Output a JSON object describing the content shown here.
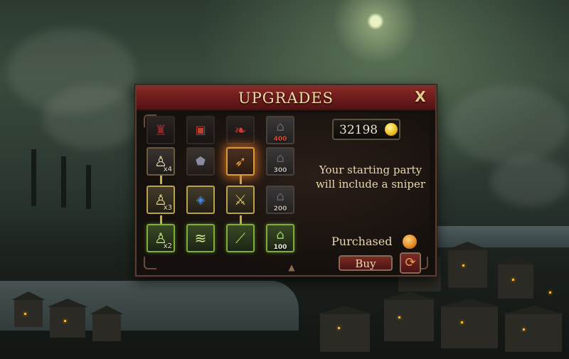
{
  "dialog": {
    "title": "UPGRADES",
    "close_label": "X"
  },
  "currency": {
    "gold": "32198",
    "coin_icon": "gold-coin-icon"
  },
  "upgrade_grid": {
    "rows": [
      [
        {
          "icon": "dynamite-figure-icon",
          "state": "dim"
        },
        {
          "icon": "supply-crate-icon",
          "state": "dim"
        },
        {
          "icon": "blade-icon",
          "state": "dim"
        },
        {
          "icon": "building-icon",
          "state": "locked",
          "cost": "400"
        }
      ],
      [
        {
          "icon": "soldier-icon",
          "state": "normal",
          "multiplier": "x4"
        },
        {
          "icon": "shield-emblem-icon",
          "state": "normal"
        },
        {
          "icon": "sniper-rifle-icon",
          "state": "selected"
        },
        {
          "icon": "building-icon",
          "state": "locked",
          "cost": "300"
        }
      ],
      [
        {
          "icon": "soldier-icon",
          "state": "gold",
          "multiplier": "x3"
        },
        {
          "icon": "blue-emblem-icon",
          "state": "gold"
        },
        {
          "icon": "rifle-icon",
          "state": "gold"
        },
        {
          "icon": "building-icon",
          "state": "locked",
          "cost": "200"
        }
      ],
      [
        {
          "icon": "soldier-icon",
          "state": "green",
          "multiplier": "x2"
        },
        {
          "icon": "rank-chevron-icon",
          "state": "green"
        },
        {
          "icon": "gun-icon",
          "state": "green"
        },
        {
          "icon": "building-icon",
          "state": "green",
          "cost": "100"
        }
      ]
    ]
  },
  "details": {
    "description_line1": "Your starting party",
    "description_line2": "will include a sniper",
    "status_label": "Purchased"
  },
  "actions": {
    "buy_label": "Buy",
    "refresh_icon": "refresh-icon"
  },
  "colors": {
    "title_bar": "#7a2220",
    "gold_border": "#b9a24a",
    "green_border": "#7fae3a",
    "selected_glow": "#e07828",
    "locked_cost": "#d84a3a"
  }
}
